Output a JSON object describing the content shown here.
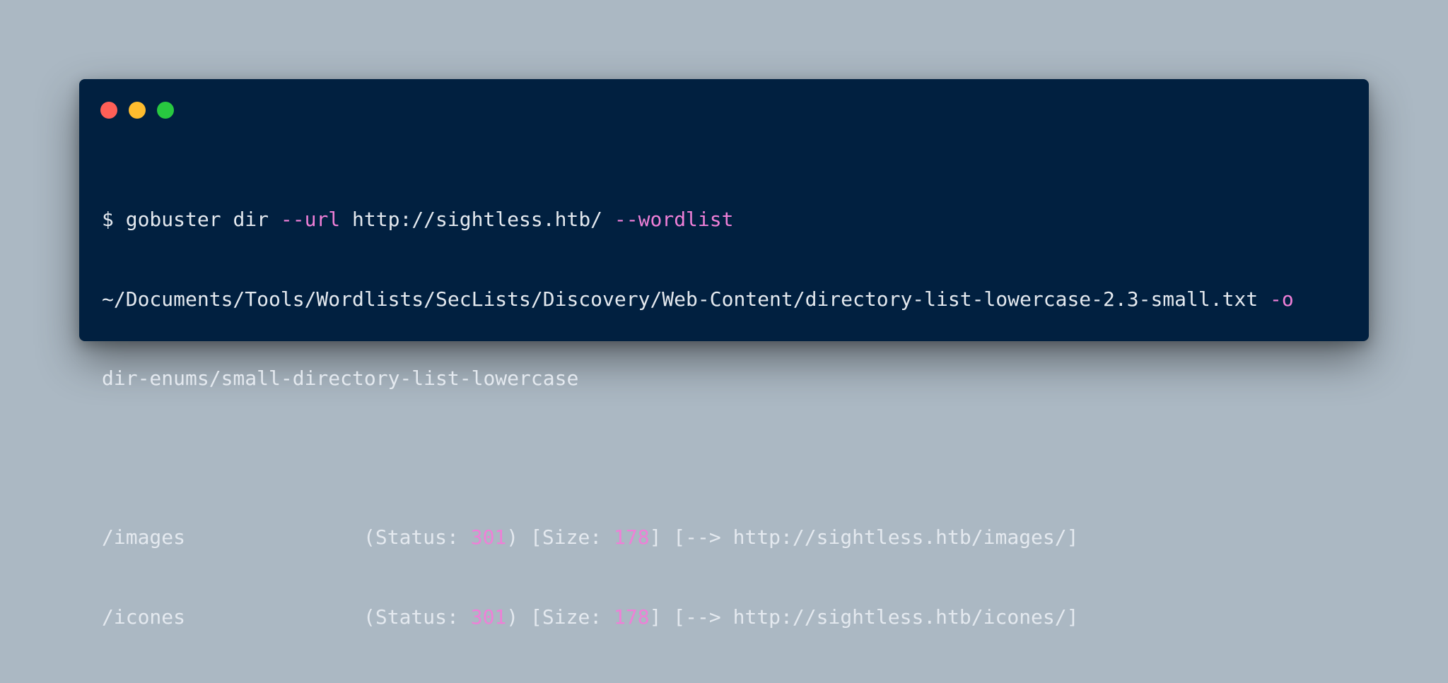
{
  "colors": {
    "background": "#abb8c3",
    "window_bg": "#012040",
    "text": "#e4e9ef",
    "accent": "#ef7fd7",
    "close_button": "#ff5f57",
    "minimize_button": "#febc2e",
    "maximize_button": "#28c840"
  },
  "window_controls": [
    {
      "name": "close-button-icon"
    },
    {
      "name": "minimize-button-icon"
    },
    {
      "name": "maximize-button-icon"
    }
  ],
  "command": {
    "prompt": "$",
    "program": "gobuster",
    "subcommand": "dir",
    "url_flag": "--url",
    "url_value": "http://sightless.htb/",
    "wordlist_flag": "--wordlist",
    "wordlist_path": "~/Documents/Tools/Wordlists/SecLists/Discovery/Web-Content/directory-list-lowercase-2.3-small.txt",
    "output_flag": "-o",
    "output_path": "dir-enums/small-directory-list-lowercase"
  },
  "results": [
    {
      "path": "/images",
      "status_label": "(Status:",
      "status": "301",
      "size_label": ") [Size:",
      "size": "178",
      "redirect_arrow": "] [-->",
      "redirect_url": "http://sightless.htb/images/]"
    },
    {
      "path": "/icones",
      "status_label": "(Status:",
      "status": "301",
      "size_label": ") [Size:",
      "size": "178",
      "redirect_arrow": "] [-->",
      "redirect_url": "http://sightless.htb/icones/]"
    }
  ]
}
